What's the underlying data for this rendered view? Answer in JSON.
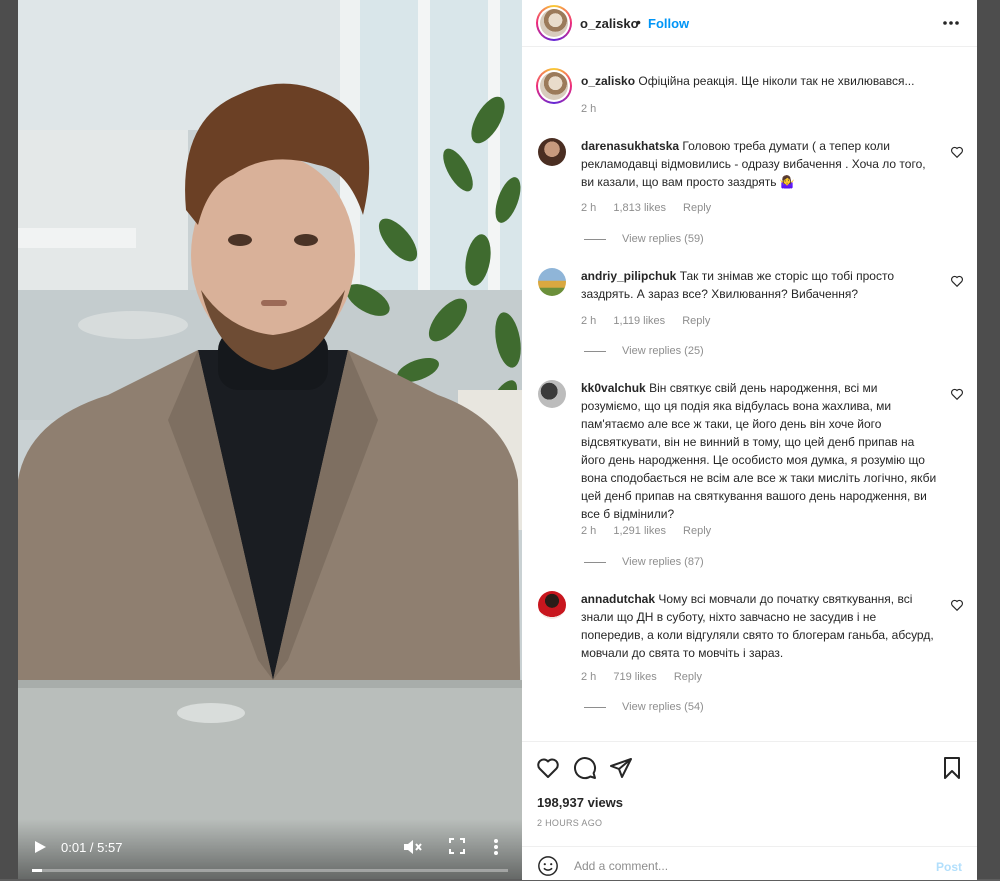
{
  "post": {
    "username": "o_zalisko",
    "separator": "•",
    "follow_label": "Follow",
    "caption": "Офіційна реакція. Ще ніколи так не хвилювався...",
    "caption_time": "2 h"
  },
  "video": {
    "time": "0:01 / 5:57",
    "progress": 0.003
  },
  "comments": [
    {
      "username": "darenasukhatska",
      "text": "Головою треба думати ( а тепер коли рекламодавці відмовились - одразу вибачення . Хоча ло того, ви казали, що вам просто заздрять 🤷‍♀️",
      "time": "2 h",
      "likes": "1,813 likes",
      "reply": "Reply",
      "replies": "View replies (59)"
    },
    {
      "username": "andriy_pilipchuk",
      "text": "Так ти знімав же сторіс що тобі просто заздрять. А зараз все? Хвилювання? Вибачення?",
      "time": "2 h",
      "likes": "1,119 likes",
      "reply": "Reply",
      "replies": "View replies (25)"
    },
    {
      "username": "kk0valchuk",
      "text": "Він святкує свій день народження, всі ми розуміємо, що ця подія яка відбулась вона жахлива, ми пам'ятаємо але все ж таки, це його день він хоче його відсвяткувати, він не винний в тому, що цей денб припав на його день народження. Це особисто моя думка, я розумію що вона сподобається не всім але все ж таки мисліть логічно, якби цей денб припав на святкування вашого день народження, ви все б відмінили?",
      "time": "2 h",
      "likes": "1,291 likes",
      "reply": "Reply",
      "replies": "View replies (87)"
    },
    {
      "username": "annadutchak",
      "text": "Чому всі мовчали до початку святкування, всі знали що ДН в суботу, ніхто завчасно не засудив і не попередив, а коли відгуляли свято то блогерам ганьба, абсурд, мовчали до свята то мовчіть і зараз.",
      "time": "2 h",
      "likes": "719 likes",
      "reply": "Reply",
      "replies": "View replies (54)"
    }
  ],
  "stats": {
    "views": "198,937 views",
    "ago": "2 HOURS AGO"
  },
  "add_comment": {
    "placeholder": "Add a comment...",
    "post_label": "Post"
  },
  "icons": {
    "play": "play-icon",
    "mute": "mute-icon",
    "fullscreen": "fullscreen-icon",
    "more": "more-vertical-icon",
    "options": "more-horizontal-icon",
    "like": "heart-icon",
    "comment": "comment-icon",
    "share": "share-icon",
    "save": "bookmark-icon",
    "emoji": "emoji-icon"
  },
  "colors": {
    "accent": "#0095f6",
    "post_disabled": "#b2dffc",
    "muted": "#8e8e8e"
  }
}
